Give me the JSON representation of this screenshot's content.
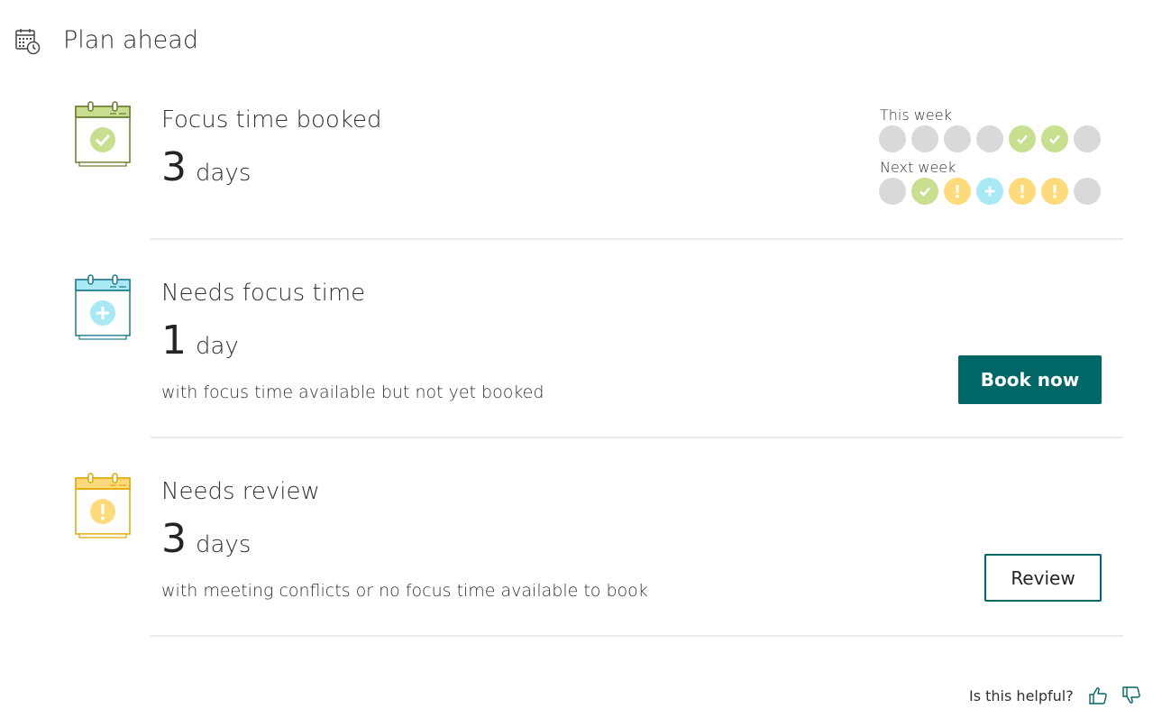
{
  "header": {
    "title": "Plan ahead",
    "icon": "calendar-clock-icon"
  },
  "accent_color": "#006666",
  "cards": [
    {
      "title": "Focus time booked",
      "count": "3",
      "unit": "days",
      "icon": "calendar-check-icon",
      "icon_color": "#c8df8f"
    },
    {
      "title": "Needs focus time",
      "count": "1",
      "unit": "day",
      "description": "with focus time available but not yet booked",
      "button_label": "Book now",
      "icon": "calendar-plus-icon",
      "icon_color": "#a8e9f5"
    },
    {
      "title": "Needs review",
      "count": "3",
      "unit": "days",
      "description": "with meeting conflicts or no focus time available to book",
      "button_label": "Review",
      "icon": "calendar-alert-icon",
      "icon_color": "#fddb7d"
    }
  ],
  "weeks": {
    "this_week": {
      "label": "This week",
      "days": [
        "empty",
        "empty",
        "empty",
        "empty",
        "booked",
        "booked",
        "empty"
      ]
    },
    "next_week": {
      "label": "Next week",
      "days": [
        "empty",
        "booked",
        "review",
        "needs",
        "review",
        "review",
        "empty"
      ]
    }
  },
  "status_colors": {
    "empty": "#d9d9d9",
    "booked": "#c8df8f",
    "needs": "#a8e9f5",
    "review": "#fddb7d"
  },
  "feedback": {
    "question": "Is this helpful?",
    "thumbs_up_icon": "thumbs-up-icon",
    "thumbs_down_icon": "thumbs-down-icon"
  }
}
